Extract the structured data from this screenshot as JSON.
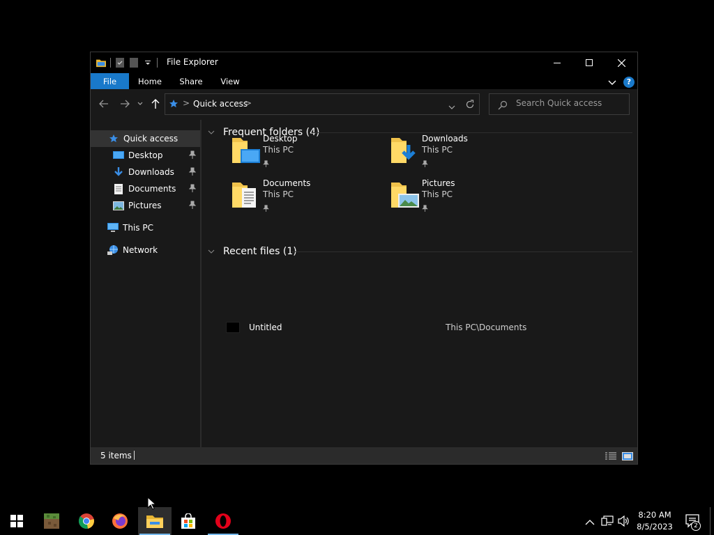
{
  "window": {
    "title": "File Explorer",
    "controls": {
      "minimize": "minimize",
      "maximize": "maximize",
      "close": "close"
    }
  },
  "ribbon": {
    "tabs": [
      {
        "label": "File"
      },
      {
        "label": "Home"
      },
      {
        "label": "Share"
      },
      {
        "label": "View"
      }
    ],
    "help_label": "?"
  },
  "navbar": {
    "breadcrumb": "Quick access",
    "separator": ">",
    "search_placeholder": "Search Quick access"
  },
  "sidebar": {
    "items": [
      {
        "label": "Quick access",
        "icon": "star-icon",
        "active": true
      },
      {
        "label": "Desktop",
        "icon": "desktop-folder-icon",
        "pinned": true
      },
      {
        "label": "Downloads",
        "icon": "download-arrow-icon",
        "pinned": true
      },
      {
        "label": "Documents",
        "icon": "documents-icon",
        "pinned": true
      },
      {
        "label": "Pictures",
        "icon": "pictures-icon",
        "pinned": true
      },
      {
        "label": "This PC",
        "icon": "computer-icon"
      },
      {
        "label": "Network",
        "icon": "network-icon"
      }
    ]
  },
  "content": {
    "frequent_header": "Frequent folders (4)",
    "recent_header": "Recent files (1)",
    "folders": [
      {
        "name": "Desktop",
        "location": "This PC"
      },
      {
        "name": "Downloads",
        "location": "This PC"
      },
      {
        "name": "Documents",
        "location": "This PC"
      },
      {
        "name": "Pictures",
        "location": "This PC"
      }
    ],
    "recent_files": [
      {
        "name": "Untitled",
        "path": "This PC\\Documents"
      }
    ]
  },
  "status": {
    "item_count": "5 items"
  },
  "taskbar": {
    "apps": [
      "start-icon",
      "minecraft-icon",
      "chrome-icon",
      "firefox-icon",
      "file-explorer-icon",
      "store-icon",
      "opera-icon"
    ],
    "time": "8:20 AM",
    "date": "8/5/2023",
    "notification_count": "2"
  },
  "colors": {
    "accent": "#1979ca",
    "window_bg": "#191919",
    "titlebar_bg": "#000000",
    "folder_yellow": "#f4c542"
  }
}
